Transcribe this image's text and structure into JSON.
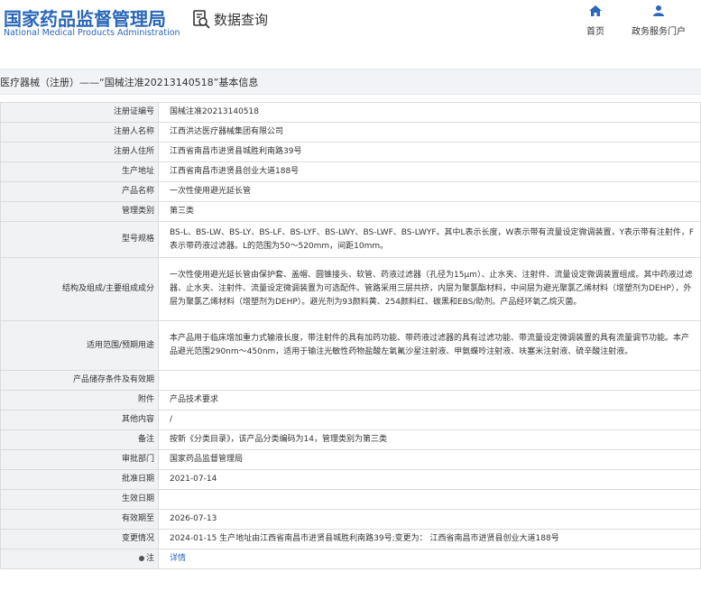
{
  "header": {
    "site_title_cn": "国家药品监督管理局",
    "site_title_en": "National Medical Products Administration",
    "query_label": "数据查询",
    "nav": [
      {
        "label": "首页",
        "icon": "home-icon"
      },
      {
        "label": "政务服务门户",
        "icon": "user-icon"
      }
    ]
  },
  "breadcrumb": "医疗器械（注册）——“国械注准20213140518”基本信息",
  "rows": [
    {
      "label": "注册证编号",
      "value": "国械注准20213140518"
    },
    {
      "label": "注册人名称",
      "value": "江西洪达医疗器械集团有限公司"
    },
    {
      "label": "注册人住所",
      "value": "江西省南昌市进贤县城胜利南路39号"
    },
    {
      "label": "生产地址",
      "value": "江西省南昌市进贤县创业大道188号"
    },
    {
      "label": "产品名称",
      "value": "一次性使用避光延长管"
    },
    {
      "label": "管理类别",
      "value": "第三类"
    },
    {
      "label": "型号规格",
      "value": "BS-L、BS-LW、BS-LY、BS-LF、BS-LYF、BS-LWY、BS-LWF、BS-LWYF。其中L表示长度，W表示带有流量设定微调装置，Y表示带有注射件，F表示带药液过滤器。L的范围为50～520mm，间距10mm。"
    },
    {
      "label": "结构及组成/主要组成成分",
      "value": "一次性使用避光延长管由保护套、盖帽、圆锥接头、软管、药液过滤器（孔径为15μm）、止水夹、注射件、流量设定微调装置组成。其中药液过滤器、止水夹、注射件、流量设定微调装置为可选配件。管路采用三层共挤，内层为聚氯酯材料，中间层为避光聚氯乙烯材料（增塑剂为DEHP），外层为聚氯乙烯材料（增塑剂为DEHP）。避光剂为93颜料黄、254颜料红、碳黑和EBS/助剂。产品经环氧乙烷灭菌。"
    },
    {
      "label": "适用范围/预期用途",
      "value": "本产品用于临床增加重力式输液长度，带注射件的具有加药功能、带药液过滤器的具有过滤功能、带流量设定微调装置的具有流量调节功能。本产品避光范围290nm～450nm，适用于输注光敏性药物盐酸左氧氟沙星注射液、甲氨蝶呤注射液、呋塞米注射液、硫辛酸注射液。"
    },
    {
      "label": "产品储存条件及有效期",
      "value": ""
    },
    {
      "label": "附件",
      "value": "产品技术要求"
    },
    {
      "label": "其他内容",
      "value": "/"
    },
    {
      "label": "备注",
      "value": "按新《分类目录》，该产品分类编码为14，管理类别为第三类"
    },
    {
      "label": "审批部门",
      "value": "国家药品监督管理局"
    },
    {
      "label": "批准日期",
      "value": "2021-07-14"
    },
    {
      "label": "生效日期",
      "value": ""
    },
    {
      "label": "有效期至",
      "value": "2026-07-13"
    },
    {
      "label": "变更情况",
      "value": "2024-01-15 生产地址由江西省南昌市进贤县城胜利南路39号;变更为： 江西省南昌市进贤县创业大道188号"
    },
    {
      "label": "注",
      "value": "详情",
      "icon": "bullet-icon"
    }
  ]
}
